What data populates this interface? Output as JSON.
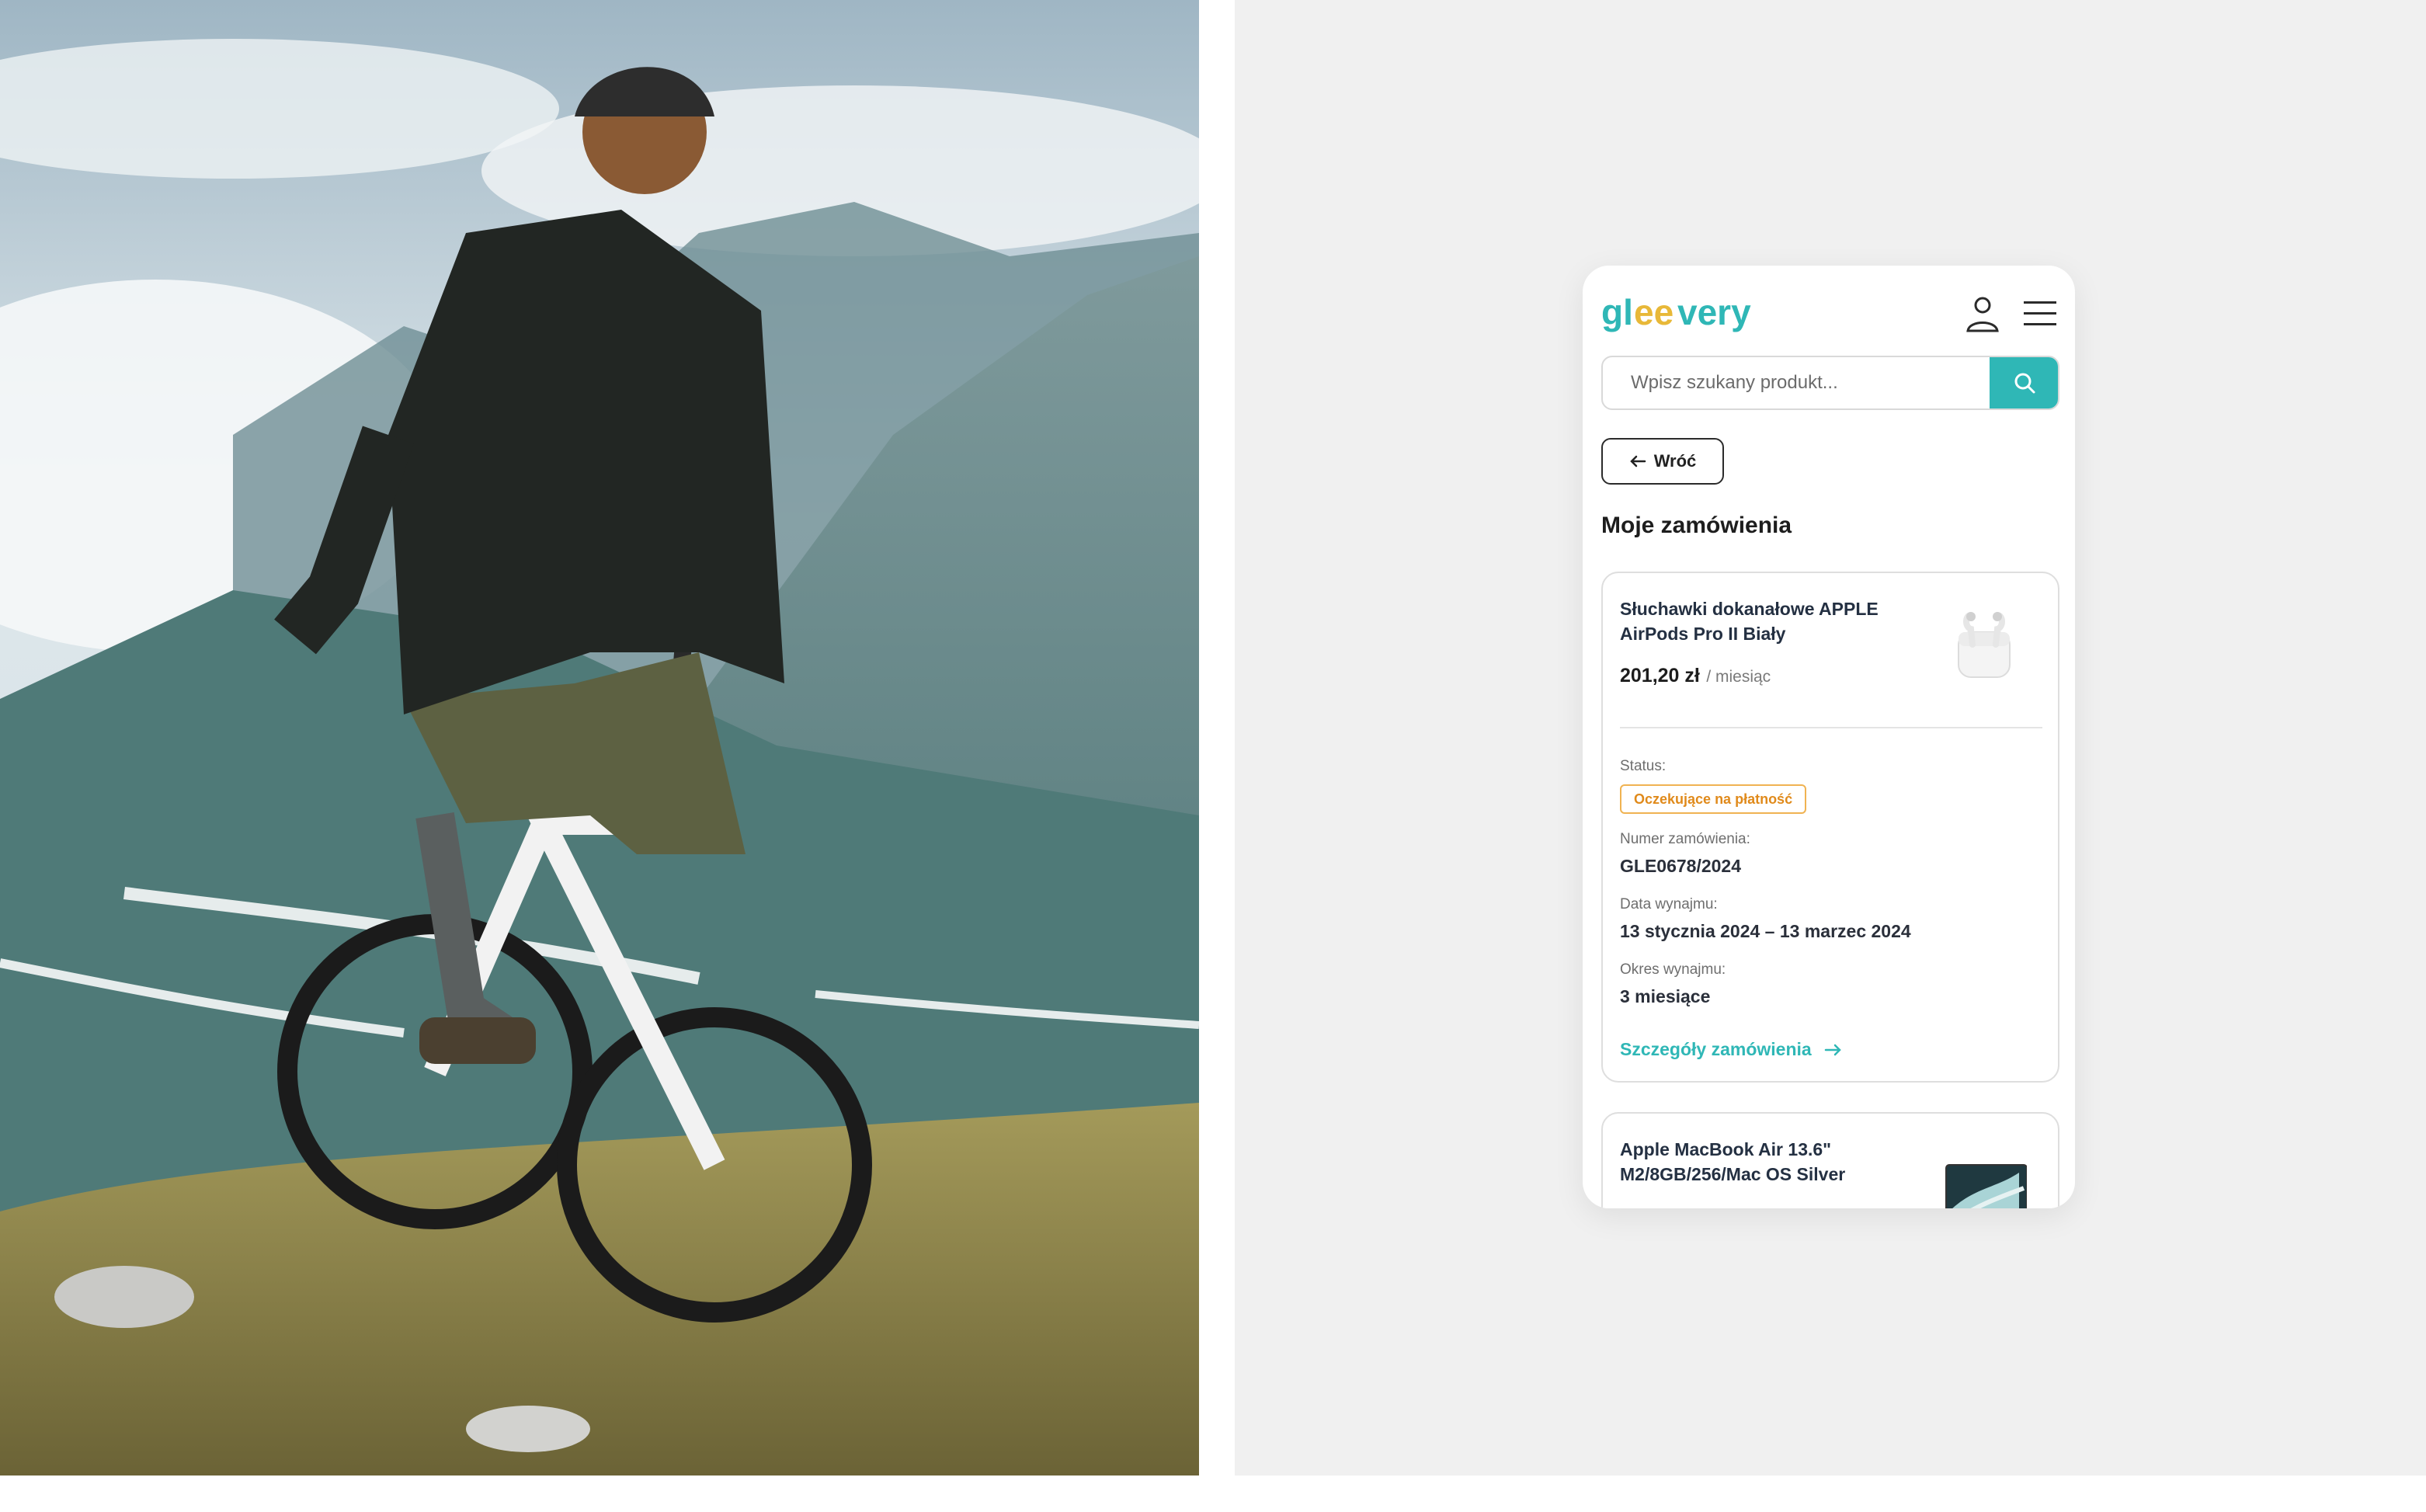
{
  "photo": {
    "description_icon": "mountain-cyclist-photo"
  },
  "header": {
    "logo_text": "gleevery",
    "user_icon": "user-icon",
    "menu_icon": "hamburger-menu-icon"
  },
  "search": {
    "placeholder": "Wpisz szukany produkt...",
    "button_icon": "search-icon"
  },
  "back_button": {
    "label": "Wróć",
    "icon": "arrow-left-icon"
  },
  "page": {
    "title": "Moje zamówienia"
  },
  "orders": [
    {
      "product": "Słuchawki dokanałowe APPLE AirPods Pro II Biały",
      "price": "201,20 zł",
      "period_suffix": "/ miesiąc",
      "status_label": "Status:",
      "status": "Oczekujące na płatność",
      "order_no_label": "Numer zamówienia:",
      "order_no": "GLE0678/2024",
      "rent_date_label": "Data wynajmu:",
      "rent_date": "13 stycznia 2024 – 13 marzec 2024",
      "rent_period_label": "Okres wynajmu:",
      "rent_period": "3 miesiące",
      "details_link": "Szczegóły zamówienia"
    },
    {
      "product": "Apple MacBook Air 13.6\" M2/8GB/256/Mac OS Silver"
    }
  ],
  "colors": {
    "accent": "#2fb7b6",
    "logo_yellow": "#e8b838",
    "status_orange": "#e08a1b",
    "panel_bg": "#f0f0f0"
  }
}
